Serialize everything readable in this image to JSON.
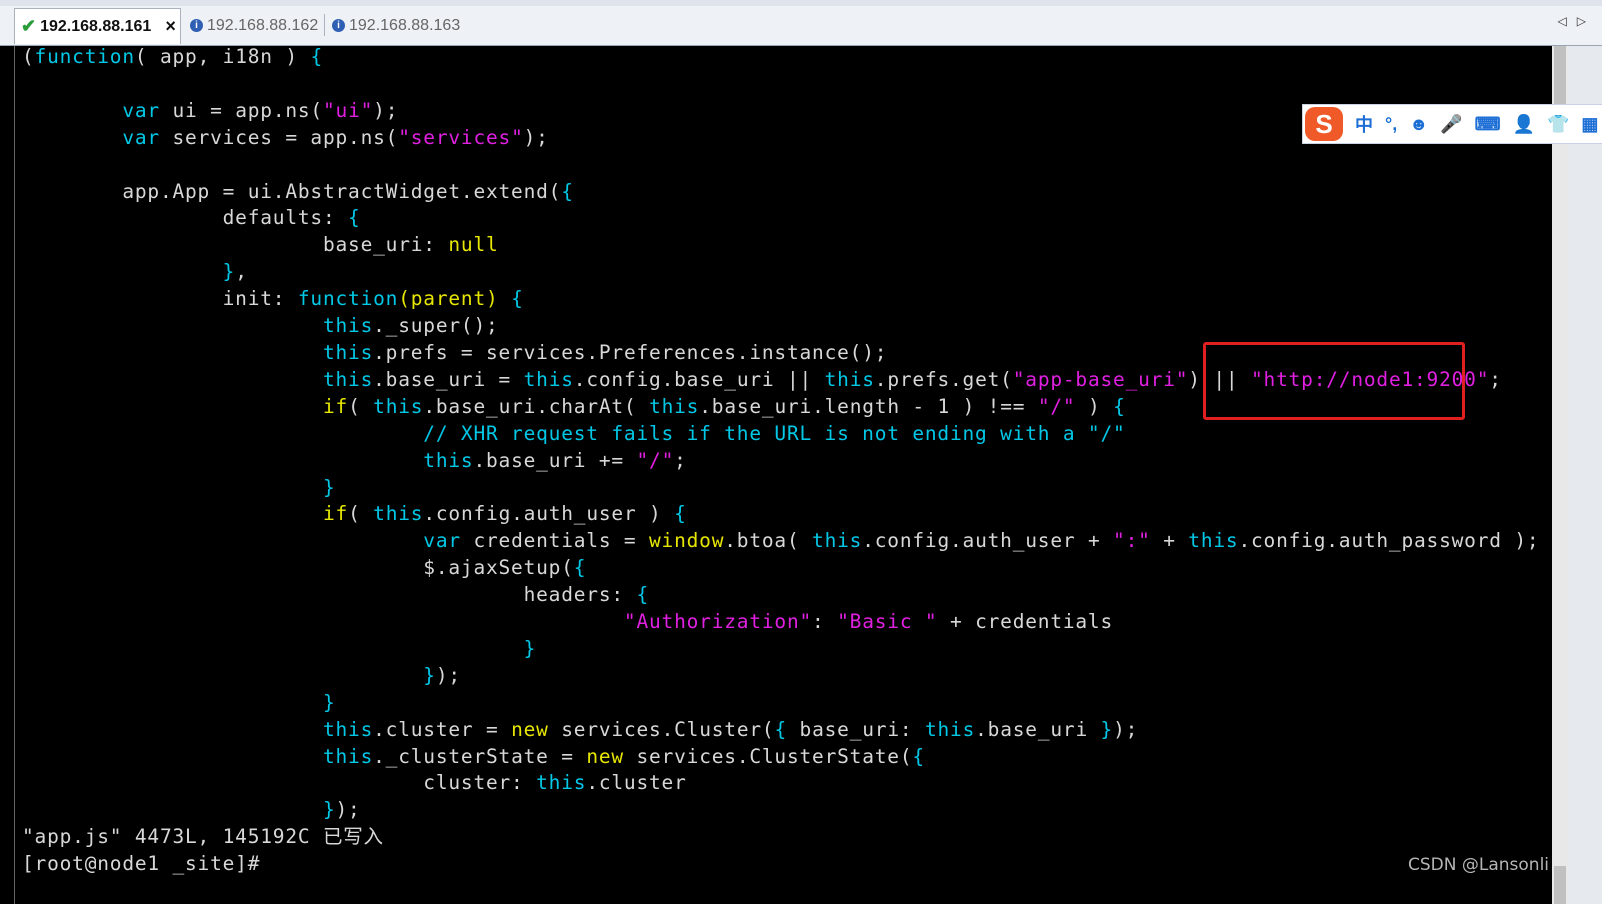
{
  "tabs": [
    {
      "label": "192.168.88.161",
      "active": true,
      "status_icon": "check-icon"
    },
    {
      "label": "192.168.88.162",
      "active": false,
      "status_icon": "info-icon"
    },
    {
      "label": "192.168.88.163",
      "active": false,
      "status_icon": "info-icon"
    }
  ],
  "tab_close_glyph": "×",
  "scroll_arrows": "◁▷",
  "ime": {
    "logo": "S",
    "lang": "中",
    "punct": "°,",
    "emoji": "☻",
    "mic": "🎤",
    "keyboard": "⌨",
    "user": "👤",
    "skin": "👕",
    "grid": "▦"
  },
  "code_lines": [
    [
      [
        "p",
        "("
      ],
      [
        "kw",
        "function"
      ],
      [
        "p",
        "( app, i18n ) "
      ],
      [
        "kw",
        "{"
      ]
    ],
    [
      [
        "p",
        ""
      ]
    ],
    [
      [
        "p",
        "        "
      ],
      [
        "kw",
        "var"
      ],
      [
        "p",
        " ui = app.ns("
      ],
      [
        "str",
        "\"ui\""
      ],
      [
        "p",
        ");"
      ]
    ],
    [
      [
        "p",
        "        "
      ],
      [
        "kw",
        "var"
      ],
      [
        "p",
        " services = app.ns("
      ],
      [
        "str",
        "\"services\""
      ],
      [
        "p",
        ");"
      ]
    ],
    [
      [
        "p",
        ""
      ]
    ],
    [
      [
        "p",
        "        app.App = ui.AbstractWidget.extend("
      ],
      [
        "kw",
        "{"
      ]
    ],
    [
      [
        "p",
        "                defaults: "
      ],
      [
        "kw",
        "{"
      ]
    ],
    [
      [
        "p",
        "                        base_uri: "
      ],
      [
        "fn",
        "null"
      ]
    ],
    [
      [
        "p",
        "                "
      ],
      [
        "kw",
        "}"
      ],
      [
        "p",
        ","
      ]
    ],
    [
      [
        "p",
        "                init: "
      ],
      [
        "kw",
        "function"
      ],
      [
        "fn",
        "(parent)"
      ],
      [
        "p",
        " "
      ],
      [
        "kw",
        "{"
      ]
    ],
    [
      [
        "p",
        "                        "
      ],
      [
        "kw",
        "this"
      ],
      [
        "p",
        "._super();"
      ]
    ],
    [
      [
        "p",
        "                        "
      ],
      [
        "kw",
        "this"
      ],
      [
        "p",
        ".prefs = services.Preferences.instance();"
      ]
    ],
    [
      [
        "p",
        "                        "
      ],
      [
        "kw",
        "this"
      ],
      [
        "p",
        ".base_uri = "
      ],
      [
        "kw",
        "this"
      ],
      [
        "p",
        ".config.base_uri || "
      ],
      [
        "kw",
        "this"
      ],
      [
        "p",
        ".prefs.get("
      ],
      [
        "str",
        "\"app-base_uri\""
      ],
      [
        "p",
        ") || "
      ],
      [
        "str",
        "\"http://node1:9200\""
      ],
      [
        "p",
        ";"
      ]
    ],
    [
      [
        "p",
        "                        "
      ],
      [
        "fn",
        "if"
      ],
      [
        "p",
        "( "
      ],
      [
        "kw",
        "this"
      ],
      [
        "p",
        ".base_uri.charAt( "
      ],
      [
        "kw",
        "this"
      ],
      [
        "p",
        ".base_uri.length - 1 ) !== "
      ],
      [
        "str",
        "\"/\""
      ],
      [
        "p",
        " ) "
      ],
      [
        "kw",
        "{"
      ]
    ],
    [
      [
        "p",
        "                                "
      ],
      [
        "cm",
        "// XHR request fails if the URL is not ending with a \"/\""
      ]
    ],
    [
      [
        "p",
        "                                "
      ],
      [
        "kw",
        "this"
      ],
      [
        "p",
        ".base_uri += "
      ],
      [
        "str",
        "\"/\""
      ],
      [
        "p",
        ";"
      ]
    ],
    [
      [
        "p",
        "                        "
      ],
      [
        "kw",
        "}"
      ]
    ],
    [
      [
        "p",
        "                        "
      ],
      [
        "fn",
        "if"
      ],
      [
        "p",
        "( "
      ],
      [
        "kw",
        "this"
      ],
      [
        "p",
        ".config.auth_user ) "
      ],
      [
        "kw",
        "{"
      ]
    ],
    [
      [
        "p",
        "                                "
      ],
      [
        "kw",
        "var"
      ],
      [
        "p",
        " credentials = "
      ],
      [
        "fn",
        "window"
      ],
      [
        "p",
        ".btoa( "
      ],
      [
        "kw",
        "this"
      ],
      [
        "p",
        ".config.auth_user + "
      ],
      [
        "str",
        "\":\""
      ],
      [
        "p",
        " + "
      ],
      [
        "kw",
        "this"
      ],
      [
        "p",
        ".config.auth_password );"
      ]
    ],
    [
      [
        "p",
        "                                $.ajaxSetup("
      ],
      [
        "kw",
        "{"
      ]
    ],
    [
      [
        "p",
        "                                        headers: "
      ],
      [
        "kw",
        "{"
      ]
    ],
    [
      [
        "p",
        "                                                "
      ],
      [
        "str",
        "\"Authorization\""
      ],
      [
        "p",
        ": "
      ],
      [
        "str",
        "\"Basic \""
      ],
      [
        "p",
        " + credentials"
      ]
    ],
    [
      [
        "p",
        "                                        "
      ],
      [
        "kw",
        "}"
      ]
    ],
    [
      [
        "p",
        "                                "
      ],
      [
        "kw",
        "}"
      ],
      [
        "p",
        ");"
      ]
    ],
    [
      [
        "p",
        "                        "
      ],
      [
        "kw",
        "}"
      ]
    ],
    [
      [
        "p",
        "                        "
      ],
      [
        "kw",
        "this"
      ],
      [
        "p",
        ".cluster = "
      ],
      [
        "fn",
        "new"
      ],
      [
        "p",
        " services.Cluster("
      ],
      [
        "kw",
        "{"
      ],
      [
        "p",
        " base_uri: "
      ],
      [
        "kw",
        "this"
      ],
      [
        "p",
        ".base_uri "
      ],
      [
        "kw",
        "}"
      ],
      [
        "p",
        ");"
      ]
    ],
    [
      [
        "p",
        "                        "
      ],
      [
        "kw",
        "this"
      ],
      [
        "p",
        "._clusterState = "
      ],
      [
        "fn",
        "new"
      ],
      [
        "p",
        " services.ClusterState("
      ],
      [
        "kw",
        "{"
      ]
    ],
    [
      [
        "p",
        "                                cluster: "
      ],
      [
        "kw",
        "this"
      ],
      [
        "p",
        ".cluster"
      ]
    ],
    [
      [
        "p",
        "                        "
      ],
      [
        "kw",
        "}"
      ],
      [
        "p",
        ");"
      ]
    ],
    [
      [
        "p",
        "\"app.js\" 4473L, 145192C 已写入"
      ]
    ],
    [
      [
        "p",
        "[root@node1 _site]#"
      ]
    ]
  ],
  "watermark": "CSDN @Lansonli",
  "colors": {
    "keyword": "#00c8e6",
    "function": "#e6e600",
    "string": "#e020e0",
    "text": "#d8d8d8",
    "highlight_box": "#e02020"
  }
}
